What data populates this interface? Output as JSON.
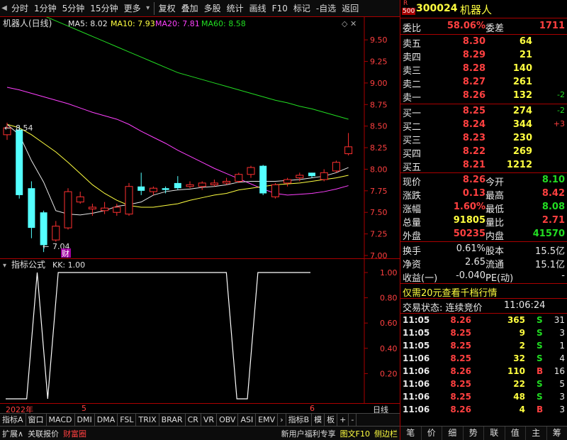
{
  "toolbar": {
    "items": [
      "分时",
      "1分钟",
      "5分钟",
      "15分钟",
      "更多",
      "复权",
      "叠加",
      "多股",
      "统计",
      "画线",
      "F10",
      "标记",
      "-自选",
      "返回"
    ]
  },
  "chart": {
    "title": "机器人(日线)",
    "ma_legend": [
      {
        "label": "MA5: 8.02",
        "color": "#e8e8e8"
      },
      {
        "label": "MA10: 7.93",
        "color": "#ffff40"
      },
      {
        "label": "MA20: 7.81",
        "color": "#ff40ff"
      },
      {
        "label": "MA60: 8.58",
        "color": "#22dd22"
      }
    ],
    "high_label": "8.54",
    "low_label": "7.04",
    "cai_label": "财",
    "y_ticks": [
      "9.50",
      "9.25",
      "9.00",
      "8.75",
      "8.50",
      "8.25",
      "8.00",
      "7.75",
      "7.50",
      "7.25",
      "7.00"
    ]
  },
  "chart_data": {
    "type": "candlestick",
    "title": "机器人(日线)",
    "y_range": [
      7.0,
      9.6
    ],
    "candles": [
      {
        "o": 8.4,
        "h": 8.54,
        "l": 8.34,
        "c": 8.48
      },
      {
        "o": 8.46,
        "h": 8.5,
        "l": 7.66,
        "c": 7.7
      },
      {
        "o": 7.78,
        "h": 7.86,
        "l": 7.2,
        "c": 7.32
      },
      {
        "o": 7.5,
        "h": 7.52,
        "l": 7.04,
        "c": 7.12
      },
      {
        "o": 7.18,
        "h": 7.4,
        "l": 7.16,
        "c": 7.34
      },
      {
        "o": 7.32,
        "h": 7.78,
        "l": 7.3,
        "c": 7.74
      },
      {
        "o": 7.62,
        "h": 7.74,
        "l": 7.6,
        "c": 7.68
      },
      {
        "o": 7.54,
        "h": 7.6,
        "l": 7.46,
        "c": 7.56
      },
      {
        "o": 7.52,
        "h": 7.62,
        "l": 7.48,
        "c": 7.55
      },
      {
        "o": 7.5,
        "h": 7.6,
        "l": 7.46,
        "c": 7.56
      },
      {
        "o": 7.48,
        "h": 7.84,
        "l": 7.46,
        "c": 7.8
      },
      {
        "o": 7.8,
        "h": 7.96,
        "l": 7.7,
        "c": 7.75
      },
      {
        "o": 7.74,
        "h": 7.8,
        "l": 7.7,
        "c": 7.78
      },
      {
        "o": 7.78,
        "h": 7.8,
        "l": 7.72,
        "c": 7.76
      },
      {
        "o": 7.84,
        "h": 7.92,
        "l": 7.76,
        "c": 7.78
      },
      {
        "o": 7.8,
        "h": 7.86,
        "l": 7.78,
        "c": 7.82
      },
      {
        "o": 7.8,
        "h": 7.86,
        "l": 7.76,
        "c": 7.84
      },
      {
        "o": 7.82,
        "h": 7.88,
        "l": 7.8,
        "c": 7.84
      },
      {
        "o": 7.84,
        "h": 7.9,
        "l": 7.82,
        "c": 7.86
      },
      {
        "o": 7.86,
        "h": 7.96,
        "l": 7.84,
        "c": 7.94
      },
      {
        "o": 7.94,
        "h": 8.04,
        "l": 7.9,
        "c": 8.02
      },
      {
        "o": 8.04,
        "h": 8.05,
        "l": 7.7,
        "c": 7.72
      },
      {
        "o": 7.68,
        "h": 7.84,
        "l": 7.66,
        "c": 7.82
      },
      {
        "o": 7.84,
        "h": 7.9,
        "l": 7.8,
        "c": 7.88
      },
      {
        "o": 7.9,
        "h": 7.96,
        "l": 7.86,
        "c": 7.93
      },
      {
        "o": 7.96,
        "h": 7.96,
        "l": 7.9,
        "c": 7.92
      },
      {
        "o": 7.88,
        "h": 8.0,
        "l": 7.86,
        "c": 7.96
      },
      {
        "o": 7.98,
        "h": 8.1,
        "l": 7.96,
        "c": 8.08
      },
      {
        "o": 8.18,
        "h": 8.42,
        "l": 8.16,
        "c": 8.26
      }
    ],
    "ma5": [
      8.52,
      8.4,
      8.1,
      7.85,
      7.52,
      7.48,
      7.47,
      7.49,
      7.52,
      7.57,
      7.59,
      7.62,
      7.7,
      7.74,
      7.76,
      7.77,
      7.79,
      7.8,
      7.82,
      7.85,
      7.86,
      7.86,
      7.86,
      7.87,
      7.88,
      7.9,
      7.92,
      7.96,
      8.02
    ],
    "ma10": [
      8.52,
      8.48,
      8.4,
      8.3,
      8.2,
      8.08,
      7.95,
      7.82,
      7.72,
      7.64,
      7.58,
      7.56,
      7.56,
      7.58,
      7.6,
      7.64,
      7.67,
      7.7,
      7.72,
      7.76,
      7.78,
      7.8,
      7.82,
      7.83,
      7.84,
      7.86,
      7.88,
      7.9,
      7.93
    ],
    "ma20": [
      8.95,
      8.92,
      8.88,
      8.84,
      8.8,
      8.76,
      8.71,
      8.66,
      8.62,
      8.58,
      8.52,
      8.44,
      8.37,
      8.3,
      8.22,
      8.15,
      8.08,
      8.01,
      7.95,
      7.89,
      7.83,
      7.77,
      7.72,
      7.7,
      7.71,
      7.72,
      7.74,
      7.77,
      7.81
    ],
    "ma60": [
      9.92,
      9.88,
      9.83,
      9.78,
      9.72,
      9.66,
      9.6,
      9.54,
      9.48,
      9.42,
      9.36,
      9.3,
      9.24,
      9.18,
      9.12,
      9.08,
      9.04,
      9.0,
      8.96,
      8.92,
      8.88,
      8.84,
      8.8,
      8.77,
      8.73,
      8.7,
      8.66,
      8.62,
      8.58
    ],
    "kk": [
      0,
      0,
      0,
      1,
      0,
      1,
      1,
      1,
      1,
      1,
      1,
      1,
      1,
      1,
      1,
      1,
      1,
      1,
      1,
      1,
      1,
      1,
      0,
      0,
      1,
      1,
      1,
      1,
      1,
      1
    ],
    "kk_ticks": [
      "1.00",
      "0.80",
      "0.60",
      "0.40",
      "0.20"
    ],
    "x_labels": [
      "2022年",
      "5",
      "6"
    ]
  },
  "kk_panel": {
    "title": "指标公式",
    "legend": "KK: 1.00"
  },
  "axis_right": "日线",
  "tabs": [
    "指标A",
    "窗口",
    "MACD",
    "DMI",
    "DMA",
    "FSL",
    "TRIX",
    "BRAR",
    "CR",
    "VR",
    "OBV",
    "ASI",
    "EMV",
    "指标B",
    "模",
    "板",
    "+",
    "-"
  ],
  "bottom": [
    "扩展∧",
    "关联报价",
    "财富圈",
    "新用户福利专享",
    "图文F10",
    "侧边栏"
  ],
  "quote": {
    "badge_top": "R",
    "badge_bottom": "500",
    "code": "300024",
    "name": "机器人",
    "weibi_label": "委比",
    "weibi_value": "58.06%",
    "weicha_label": "委差",
    "weicha_value": "1711",
    "asks": [
      {
        "label": "卖五",
        "price": "8.30",
        "vol": "64",
        "chg": ""
      },
      {
        "label": "卖四",
        "price": "8.29",
        "vol": "21",
        "chg": ""
      },
      {
        "label": "卖三",
        "price": "8.28",
        "vol": "140",
        "chg": ""
      },
      {
        "label": "卖二",
        "price": "8.27",
        "vol": "261",
        "chg": ""
      },
      {
        "label": "卖一",
        "price": "8.26",
        "vol": "132",
        "chg": "-2"
      }
    ],
    "bids": [
      {
        "label": "买一",
        "price": "8.25",
        "vol": "274",
        "chg": "-2"
      },
      {
        "label": "买二",
        "price": "8.24",
        "vol": "344",
        "chg": "+3"
      },
      {
        "label": "买三",
        "price": "8.23",
        "vol": "230",
        "chg": ""
      },
      {
        "label": "买四",
        "price": "8.22",
        "vol": "269",
        "chg": ""
      },
      {
        "label": "买五",
        "price": "8.21",
        "vol": "1212",
        "chg": ""
      }
    ],
    "stats": [
      {
        "l1": "现价",
        "v1": "8.26",
        "c1": "red",
        "l2": "今开",
        "v2": "8.10",
        "c2": "grn"
      },
      {
        "l1": "涨跌",
        "v1": "0.13",
        "c1": "red",
        "l2": "最高",
        "v2": "8.42",
        "c2": "red"
      },
      {
        "l1": "涨幅",
        "v1": "1.60%",
        "c1": "red",
        "l2": "最低",
        "v2": "8.08",
        "c2": "grn"
      },
      {
        "l1": "总量",
        "v1": "91805",
        "c1": "yel",
        "l2": "量比",
        "v2": "2.71",
        "c2": "red"
      },
      {
        "l1": "外盘",
        "v1": "50235",
        "c1": "red",
        "l2": "内盘",
        "v2": "41570",
        "c2": "grn"
      }
    ],
    "stats2": [
      {
        "l1": "换手",
        "v1": "0.61%",
        "l2": "股本",
        "v2": "15.5亿"
      },
      {
        "l1": "净资",
        "v1": "2.65",
        "l2": "流通",
        "v2": "15.1亿"
      },
      {
        "l1": "收益(一)",
        "v1": "-0.040",
        "l2": "PE(动)",
        "v2": "-"
      }
    ],
    "promo": "仅需20元查看千档行情",
    "status_label": "交易状态: 连续竞价",
    "status_time": "11:06:24",
    "ticks": [
      {
        "t": "11:05",
        "p": "8.26",
        "pc": "red",
        "v": "365",
        "vc": "yel",
        "f": "S",
        "fc": "grn",
        "n": "31"
      },
      {
        "t": "11:05",
        "p": "8.25",
        "pc": "red",
        "v": "9",
        "vc": "yel",
        "f": "S",
        "fc": "grn",
        "n": "3"
      },
      {
        "t": "11:05",
        "p": "8.25",
        "pc": "red",
        "v": "2",
        "vc": "yel",
        "f": "S",
        "fc": "grn",
        "n": "1"
      },
      {
        "t": "11:06",
        "p": "8.25",
        "pc": "red",
        "v": "32",
        "vc": "yel",
        "f": "S",
        "fc": "grn",
        "n": "4"
      },
      {
        "t": "11:06",
        "p": "8.26",
        "pc": "red",
        "v": "110",
        "vc": "yel",
        "f": "B",
        "fc": "red",
        "n": "16"
      },
      {
        "t": "11:06",
        "p": "8.25",
        "pc": "red",
        "v": "22",
        "vc": "yel",
        "f": "S",
        "fc": "grn",
        "n": "5"
      },
      {
        "t": "11:06",
        "p": "8.25",
        "pc": "red",
        "v": "48",
        "vc": "yel",
        "f": "S",
        "fc": "grn",
        "n": "3"
      },
      {
        "t": "11:06",
        "p": "8.26",
        "pc": "red",
        "v": "4",
        "vc": "yel",
        "f": "B",
        "fc": "red",
        "n": "3"
      }
    ],
    "bottom_tabs": [
      "笔",
      "价",
      "细",
      "势",
      "联",
      "值",
      "主",
      "筹"
    ]
  },
  "colors": {
    "up": "#ff3030",
    "down": "#54ffff",
    "frame": "#aa0000"
  }
}
